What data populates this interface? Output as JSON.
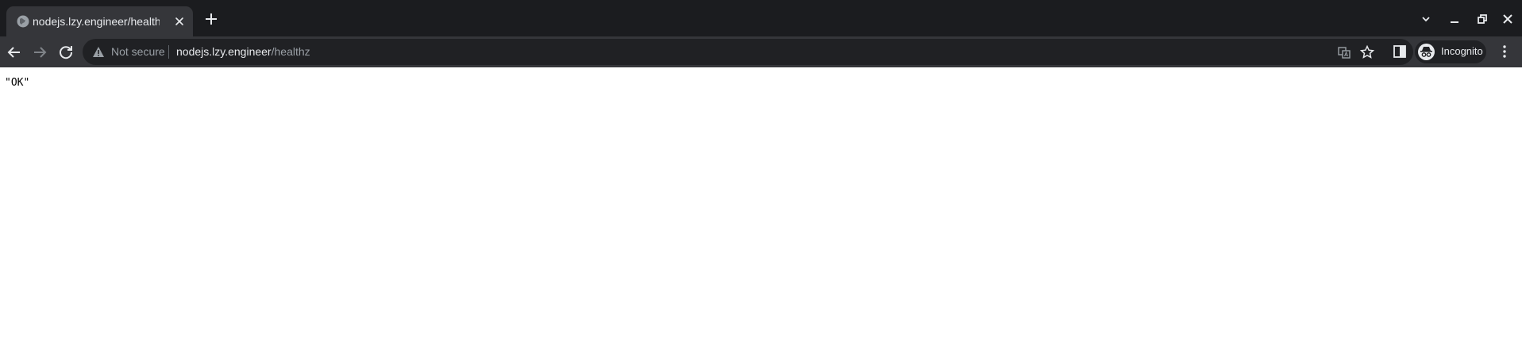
{
  "tab": {
    "title": "nodejs.lzy.engineer/healthz",
    "favicon": "globe-icon"
  },
  "omnibox": {
    "security_label": "Not secure",
    "url_host": "nodejs.lzy.engineer",
    "url_path": "/healthz"
  },
  "profile": {
    "label": "Incognito"
  },
  "page": {
    "body_text": "\"OK\""
  },
  "colors": {
    "frame": "#1b1c1f",
    "toolbar": "#35363a",
    "omnibox": "#202124",
    "text_primary": "#e8eaed",
    "text_secondary": "#9aa0a6"
  }
}
